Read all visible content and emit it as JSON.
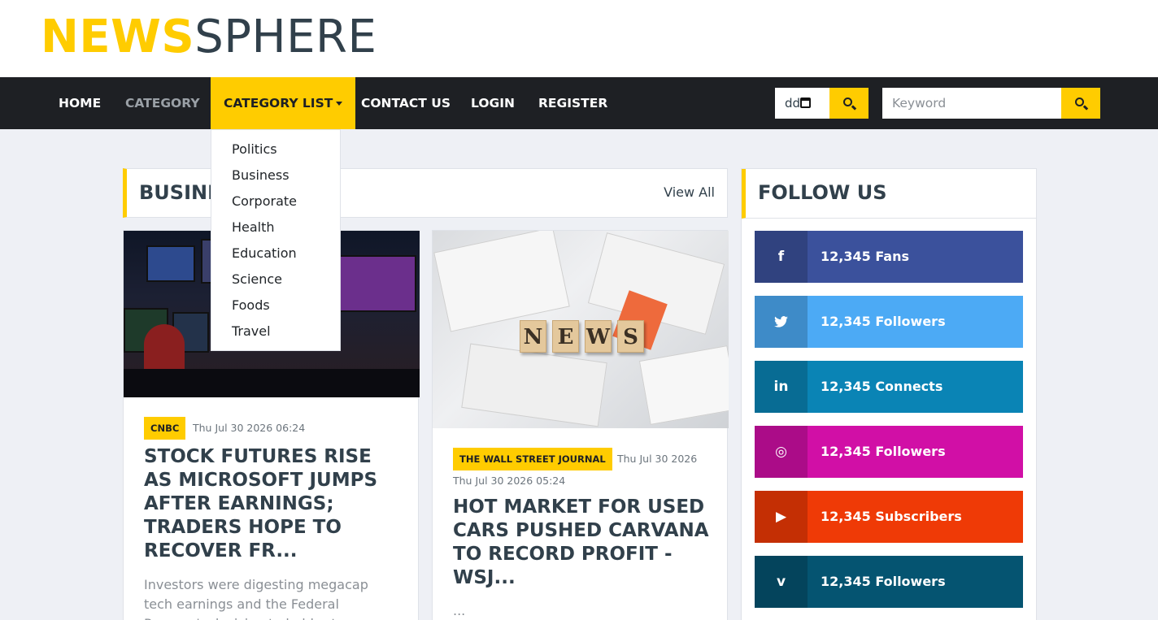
{
  "brand": {
    "logo_part1": "NEWS",
    "logo_part2": "SPHERE",
    "accent": "#ffcc00",
    "dark": "#1e2024"
  },
  "nav": {
    "items": [
      {
        "label": "Home"
      },
      {
        "label": "Category"
      },
      {
        "label": "Category List"
      },
      {
        "label": "Contact Us"
      },
      {
        "label": "Login"
      },
      {
        "label": "Register"
      }
    ],
    "date_value": "dd",
    "keyword_placeholder": "Keyword"
  },
  "dropdown": {
    "items": [
      "Politics",
      "Business",
      "Corporate",
      "Health",
      "Education",
      "Science",
      "Foods",
      "Travel"
    ]
  },
  "section": {
    "title": "Business",
    "view_all": "View All"
  },
  "articles": [
    {
      "source": "CNBC",
      "date": "Thu Jul 30 2026 06:24",
      "title": "Stock futures rise as Microsoft jumps after earnings; traders hope to recover fr...",
      "excerpt": "Investors were digesting megacap tech earnings and the Federal Reserve's decision to hold rates"
    },
    {
      "source": "The Wall Street Journal",
      "date": "Thu Jul 30 2026 05:24",
      "title": "Hot market for used cars pushed Carvana to record profit - WSJ...",
      "excerpt": "...",
      "image_text": [
        "N",
        "E",
        "W",
        "S"
      ]
    }
  ],
  "follow": {
    "title": "Follow Us",
    "items": [
      {
        "icon": "facebook-icon",
        "glyph": "f",
        "label": "12,345 Fans",
        "color": "#3b519c"
      },
      {
        "icon": "twitter-icon",
        "glyph": "t",
        "label": "12,345 Followers",
        "color": "#4caaf5"
      },
      {
        "icon": "linkedin-icon",
        "glyph": "in",
        "label": "12,345 Connects",
        "color": "#0a84b5"
      },
      {
        "icon": "instagram-icon",
        "glyph": "◎",
        "label": "12,345 Followers",
        "color": "#d10fa6"
      },
      {
        "icon": "youtube-icon",
        "glyph": "▶",
        "label": "12,345 Subscribers",
        "color": "#ef3a06"
      },
      {
        "icon": "vimeo-icon",
        "glyph": "v",
        "label": "12,345 Followers",
        "color": "#055471"
      }
    ]
  }
}
